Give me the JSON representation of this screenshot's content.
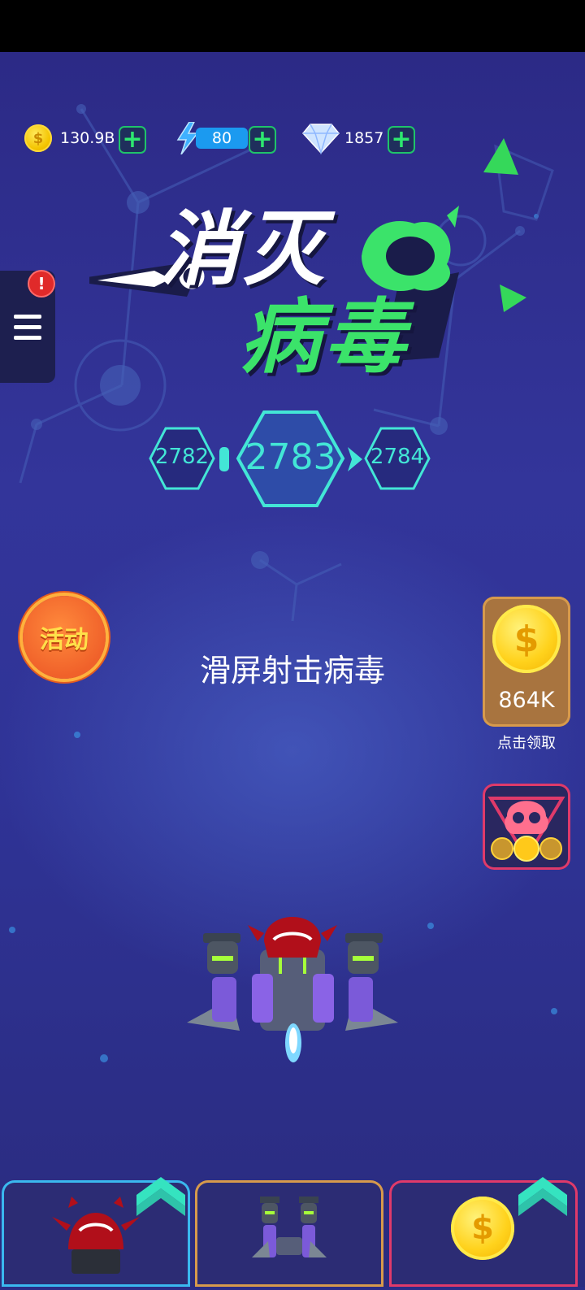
{
  "resources": {
    "coins": "130.9B",
    "energy": "80",
    "diamonds": "1857"
  },
  "logo": {
    "line1": "消灭",
    "line2": "病毒"
  },
  "menu": {
    "alert": "!"
  },
  "level": {
    "previous": "2782",
    "current": "2783",
    "next": "2784"
  },
  "activity_button": "活动",
  "hint": "滑屏射击病毒",
  "reward": {
    "amount": "864K",
    "label": "点击领取"
  },
  "icons": {
    "coin": "coin-icon",
    "energy": "lightning-icon",
    "diamond": "diamond-icon",
    "plus": "plus-icon",
    "menu": "hamburger-menu-icon",
    "upgrade": "double-chevron-up-icon"
  },
  "colors": {
    "background": "#2c2a86",
    "accent_green": "#2ee86f",
    "level_cyan": "#43e6d6",
    "energy_blue": "#1b9af0",
    "tab_weapon": "#3ab8ef",
    "tab_ship": "#d79a4c",
    "tab_coin": "#e03a6a"
  }
}
